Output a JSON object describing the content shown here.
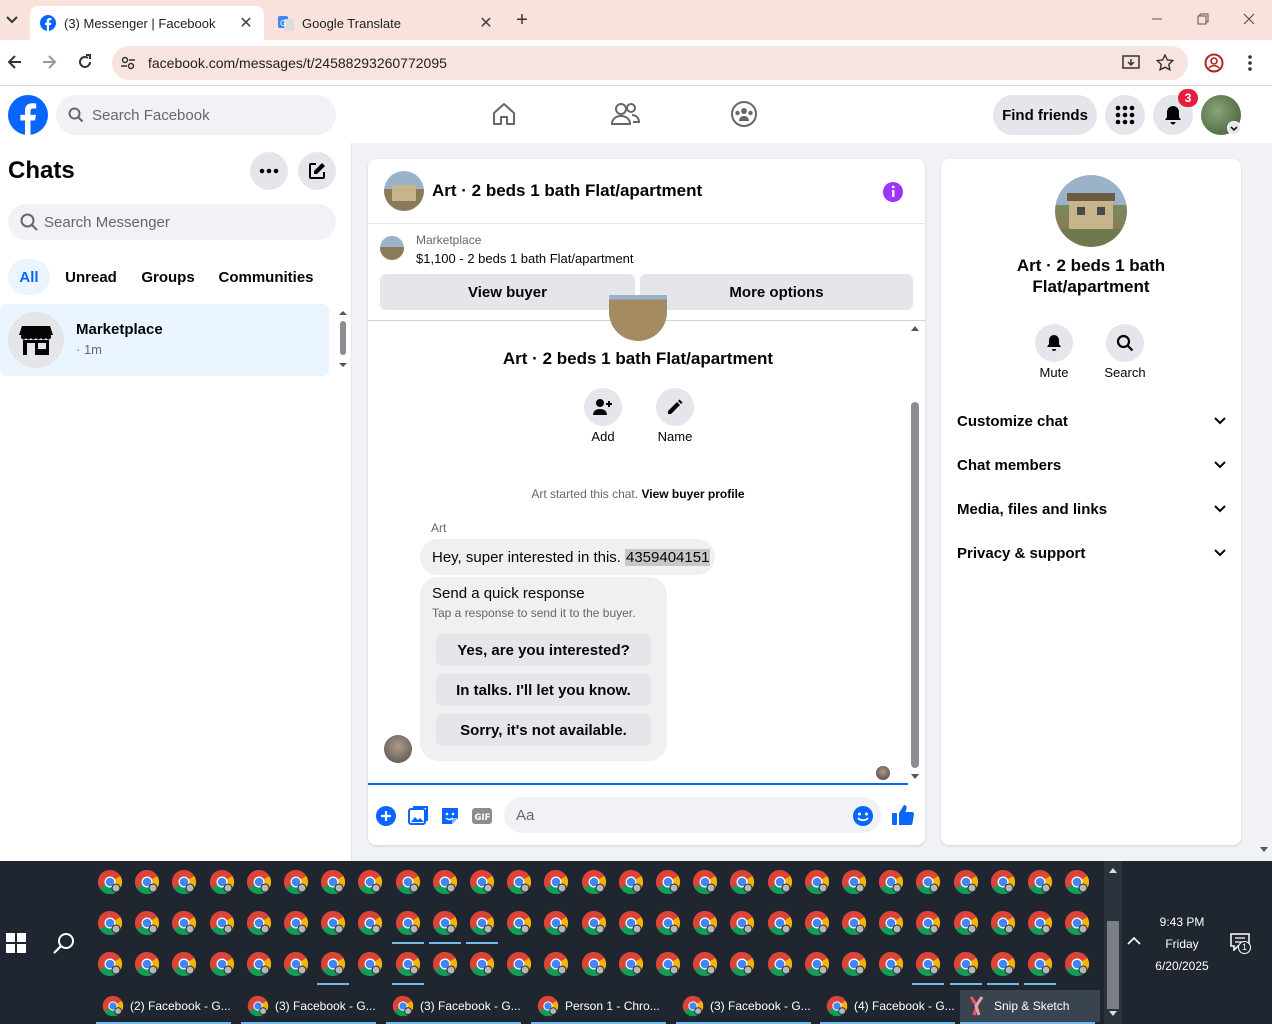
{
  "browser": {
    "tabs": [
      {
        "title": "(3) Messenger | Facebook",
        "icon": "facebook-icon",
        "active": true
      },
      {
        "title": "Google Translate",
        "icon": "translate-icon",
        "active": false
      }
    ],
    "url": "facebook.com/messages/t/24588293260772095"
  },
  "header": {
    "search_placeholder": "Search Facebook",
    "find_friends": "Find friends",
    "notification_count": "3",
    "brand_color": "#0866ff"
  },
  "sidebar": {
    "title": "Chats",
    "search_placeholder": "Search Messenger",
    "filters": [
      "All",
      "Unread",
      "Groups",
      "Communities"
    ],
    "chats": [
      {
        "name": "Marketplace",
        "time": "· 1m",
        "icon": "store-icon"
      }
    ]
  },
  "conversation": {
    "title": "Art · 2 beds 1 bath Flat/apartment",
    "listing_source": "Marketplace",
    "listing_detail": "$1,100 - 2 beds 1 bath Flat/apartment",
    "view_buyer": "View buyer",
    "more_options": "More options",
    "profile_name": "Art · 2 beds 1 bath Flat/apartment",
    "add_label": "Add",
    "name_label": "Name",
    "started_text": "Art started this chat.",
    "view_profile": "View buyer profile",
    "sender": "Art",
    "message_text": "Hey, super interested in this.",
    "message_phone": "4359404151",
    "quick_title": "Send a quick response",
    "quick_subtitle": "Tap a response to send it to the buyer.",
    "quick_responses": [
      "Yes, are you interested?",
      "In talks. I'll let you know.",
      "Sorry, it's not available."
    ],
    "composer_placeholder": "Aa"
  },
  "info_panel": {
    "name": "Art · 2 beds 1 bath Flat/apartment",
    "mute": "Mute",
    "search": "Search",
    "sections": [
      "Customize chat",
      "Chat members",
      "Media, files and links",
      "Privacy & support"
    ]
  },
  "taskbar": {
    "time": "9:43 PM",
    "day": "Friday",
    "date": "6/20/2025",
    "notif_count": "1",
    "tasks": [
      "(2) Facebook - G...",
      "(3) Facebook - G...",
      "(3) Facebook - G...",
      "Person 1 - Chro...",
      "(3) Facebook - G...",
      "(4) Facebook - G...",
      "Snip & Sketch"
    ]
  }
}
